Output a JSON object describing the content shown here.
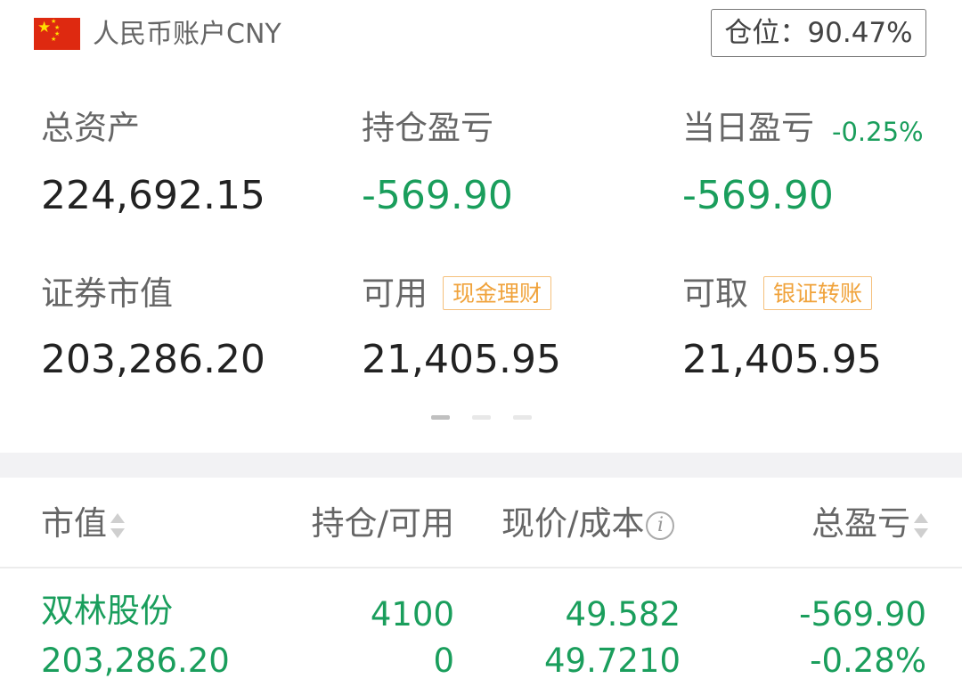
{
  "header": {
    "flag_icon": "china-flag-icon",
    "account_title": "人民币账户CNY",
    "position_label": "仓位：90.47%"
  },
  "summary": {
    "total_assets": {
      "label": "总资产",
      "value": "224,692.15"
    },
    "position_pnl": {
      "label": "持仓盈亏",
      "value": "-569.90"
    },
    "daily_pnl": {
      "label": "当日盈亏",
      "percent": "-0.25%",
      "value": "-569.90"
    },
    "securities_value": {
      "label": "证券市值",
      "value": "203,286.20"
    },
    "available": {
      "label": "可用",
      "tag": "现金理财",
      "value": "21,405.95"
    },
    "withdrawable": {
      "label": "可取",
      "tag": "银证转账",
      "value": "21,405.95"
    }
  },
  "pager": {
    "count": 3,
    "active_index": 0
  },
  "table": {
    "headers": {
      "market_value": "市值",
      "holding_available": "持仓/可用",
      "price_cost": "现价/成本",
      "total_pnl": "总盈亏"
    },
    "rows": [
      {
        "name": "双林股份",
        "market_value": "203,286.20",
        "holding": "4100",
        "available": "0",
        "price": "49.582",
        "cost": "49.7210",
        "pnl": "-569.90",
        "pnl_percent": "-0.28%"
      }
    ]
  },
  "colors": {
    "loss_green": "#1a9e5c",
    "tag_orange": "#f0a33c",
    "flag_red": "#de2910",
    "flag_star": "#ffde00"
  }
}
